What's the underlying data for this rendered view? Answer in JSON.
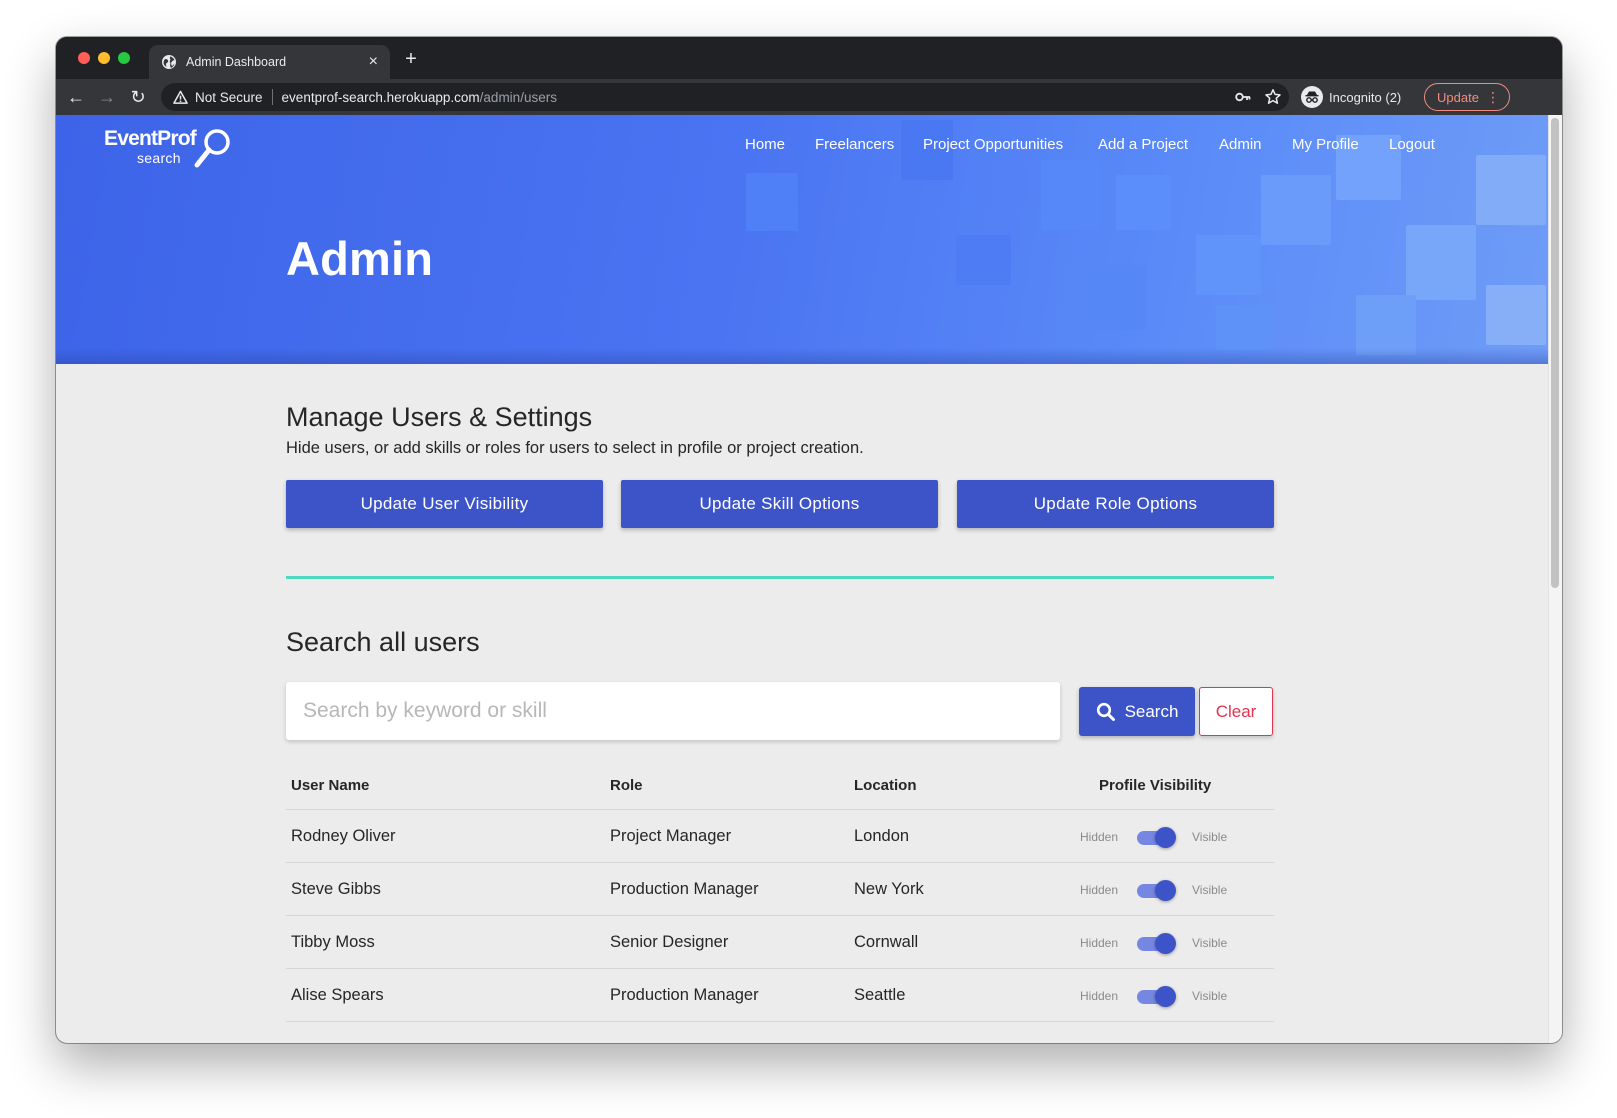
{
  "browser": {
    "tab_title": "Admin Dashboard",
    "tab_close": "×",
    "new_tab": "+",
    "security_label": "Not Secure",
    "url_host": "eventprof-search.herokuapp.com",
    "url_path": "/admin/users",
    "incognito_label": "Incognito (2)",
    "update_label": "Update",
    "menu_glyph": "⋮",
    "back_glyph": "←",
    "forward_glyph": "→",
    "reload_glyph": "↻"
  },
  "logo": {
    "word1": "EventProf",
    "word2": "search"
  },
  "nav": [
    "Home",
    "Freelancers",
    "Project Opportunities",
    "Add a Project",
    "Admin",
    "My Profile",
    "Logout"
  ],
  "hero_title": "Admin",
  "manage": {
    "heading": "Manage Users & Settings",
    "subtitle": "Hide users, or add skills or roles for users to select in profile or project creation.",
    "buttons": [
      "Update User Visibility",
      "Update Skill Options",
      "Update Role Options"
    ]
  },
  "search": {
    "heading": "Search all users",
    "placeholder": "Search by keyword or skill",
    "value": "",
    "search_label": "Search",
    "clear_label": "Clear"
  },
  "table": {
    "headers": [
      "User Name",
      "Role",
      "Location",
      "Profile Visibility"
    ],
    "rows": [
      {
        "name": "Rodney Oliver",
        "role": "Project Manager",
        "location": "London",
        "hidden_label": "Hidden",
        "visible_label": "Visible",
        "visible": true
      },
      {
        "name": "Steve Gibbs",
        "role": "Production Manager",
        "location": "New York",
        "hidden_label": "Hidden",
        "visible_label": "Visible",
        "visible": true
      },
      {
        "name": "Tibby Moss",
        "role": "Senior Designer",
        "location": "Cornwall",
        "hidden_label": "Hidden",
        "visible_label": "Visible",
        "visible": true
      },
      {
        "name": "Alise Spears",
        "role": "Production Manager",
        "location": "Seattle",
        "hidden_label": "Hidden",
        "visible_label": "Visible",
        "visible": true
      }
    ]
  },
  "colors": {
    "primary": "#3d54c9",
    "accent_divider": "#4fd8c0",
    "danger": "#e8324f",
    "hero_blue": "#4a74f2"
  }
}
